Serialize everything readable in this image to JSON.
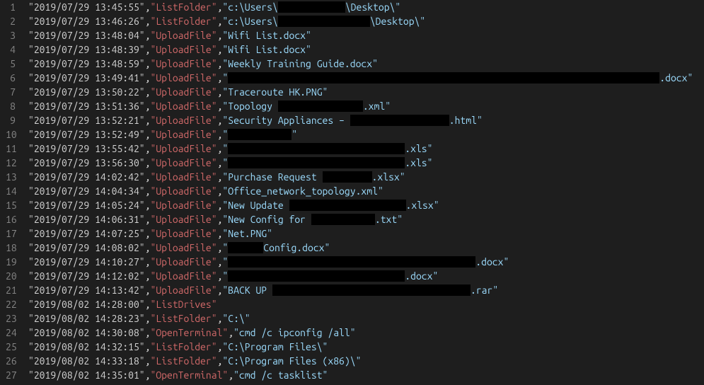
{
  "lines": [
    {
      "n": 1,
      "ts": "2019/07/29 13:45:55",
      "cmd": "ListFolder",
      "arg_pre": "c:\\Users\\",
      "redact_w": 95,
      "arg_post": "\\Desktop\\"
    },
    {
      "n": 2,
      "ts": "2019/07/29 13:46:26",
      "cmd": "ListFolder",
      "arg_pre": "c:\\Users\\",
      "redact_w": 130,
      "arg_post": "\\Desktop\\"
    },
    {
      "n": 3,
      "ts": "2019/07/29 13:48:04",
      "cmd": "UploadFile",
      "arg_pre": "Wifi List.docx",
      "redact_w": 0,
      "arg_post": ""
    },
    {
      "n": 4,
      "ts": "2019/07/29 13:48:39",
      "cmd": "UploadFile",
      "arg_pre": "Wifi List.docx",
      "redact_w": 0,
      "arg_post": ""
    },
    {
      "n": 5,
      "ts": "2019/07/29 13:48:59",
      "cmd": "UploadFile",
      "arg_pre": "Weekly Training Guide.docx",
      "redact_w": 0,
      "arg_post": ""
    },
    {
      "n": 6,
      "ts": "2019/07/29 13:49:41",
      "cmd": "UploadFile",
      "arg_pre": "",
      "redact_w": 610,
      "arg_post": ".docx"
    },
    {
      "n": 7,
      "ts": "2019/07/29 13:50:22",
      "cmd": "UploadFile",
      "arg_pre": "Traceroute HK.PNG",
      "redact_w": 0,
      "arg_post": ""
    },
    {
      "n": 8,
      "ts": "2019/07/29 13:51:36",
      "cmd": "UploadFile",
      "arg_pre": "Topology ",
      "redact_w": 120,
      "arg_post": ".xml"
    },
    {
      "n": 9,
      "ts": "2019/07/29 13:52:21",
      "cmd": "UploadFile",
      "arg_pre": "Security Appliances – ",
      "redact_w": 140,
      "arg_post": ".html"
    },
    {
      "n": 10,
      "ts": "2019/07/29 13:52:49",
      "cmd": "UploadFile",
      "arg_pre": "",
      "redact_w": 90,
      "arg_post": ""
    },
    {
      "n": 11,
      "ts": "2019/07/29 13:55:42",
      "cmd": "UploadFile",
      "arg_pre": "",
      "redact_w": 250,
      "arg_post": ".xls"
    },
    {
      "n": 12,
      "ts": "2019/07/29 13:56:30",
      "cmd": "UploadFile",
      "arg_pre": "",
      "redact_w": 250,
      "arg_post": ".xls"
    },
    {
      "n": 13,
      "ts": "2019/07/29 14:02:42",
      "cmd": "UploadFile",
      "arg_pre": "Purchase Request ",
      "redact_w": 70,
      "arg_post": ".xlsx"
    },
    {
      "n": 14,
      "ts": "2019/07/29 14:04:34",
      "cmd": "UploadFile",
      "arg_pre": "Office_network_topology.xml",
      "redact_w": 0,
      "arg_post": ""
    },
    {
      "n": 15,
      "ts": "2019/07/29 14:05:24",
      "cmd": "UploadFile",
      "arg_pre": "New Update ",
      "redact_w": 165,
      "arg_post": ".xlsx"
    },
    {
      "n": 16,
      "ts": "2019/07/29 14:06:31",
      "cmd": "UploadFile",
      "arg_pre": "New Config for ",
      "redact_w": 90,
      "arg_post": ".txt"
    },
    {
      "n": 17,
      "ts": "2019/07/29 14:07:25",
      "cmd": "UploadFile",
      "arg_pre": "Net.PNG",
      "redact_w": 0,
      "arg_post": ""
    },
    {
      "n": 18,
      "ts": "2019/07/29 14:08:02",
      "cmd": "UploadFile",
      "arg_pre": "",
      "redact_w": 50,
      "arg_post": "Config.docx"
    },
    {
      "n": 19,
      "ts": "2019/07/29 14:10:27",
      "cmd": "UploadFile",
      "arg_pre": "",
      "redact_w": 350,
      "arg_post": ".docx"
    },
    {
      "n": 20,
      "ts": "2019/07/29 14:12:02",
      "cmd": "UploadFile",
      "arg_pre": "",
      "redact_w": 250,
      "arg_post": ".docx"
    },
    {
      "n": 21,
      "ts": "2019/07/29 14:13:42",
      "cmd": "UploadFile",
      "arg_pre": "BACK UP ",
      "redact_w": 280,
      "arg_post": ".rar"
    },
    {
      "n": 22,
      "ts": "2019/08/02 14:28:00",
      "cmd": "ListDrives",
      "arg_pre": null,
      "redact_w": 0,
      "arg_post": ""
    },
    {
      "n": 23,
      "ts": "2019/08/02 14:28:23",
      "cmd": "ListFolder",
      "arg_pre": "C:\\",
      "redact_w": 0,
      "arg_post": ""
    },
    {
      "n": 24,
      "ts": "2019/08/02 14:30:08",
      "cmd": "OpenTerminal",
      "arg_pre": "cmd /c ipconfig /all",
      "redact_w": 0,
      "arg_post": ""
    },
    {
      "n": 25,
      "ts": "2019/08/02 14:32:15",
      "cmd": "ListFolder",
      "arg_pre": "C:\\Program Files\\",
      "redact_w": 0,
      "arg_post": ""
    },
    {
      "n": 26,
      "ts": "2019/08/02 14:33:18",
      "cmd": "ListFolder",
      "arg_pre": "C:\\Program Files (x86)\\",
      "redact_w": 0,
      "arg_post": ""
    },
    {
      "n": 27,
      "ts": "2019/08/02 14:35:01",
      "cmd": "OpenTerminal",
      "arg_pre": "cmd /c tasklist",
      "redact_w": 0,
      "arg_post": ""
    }
  ]
}
